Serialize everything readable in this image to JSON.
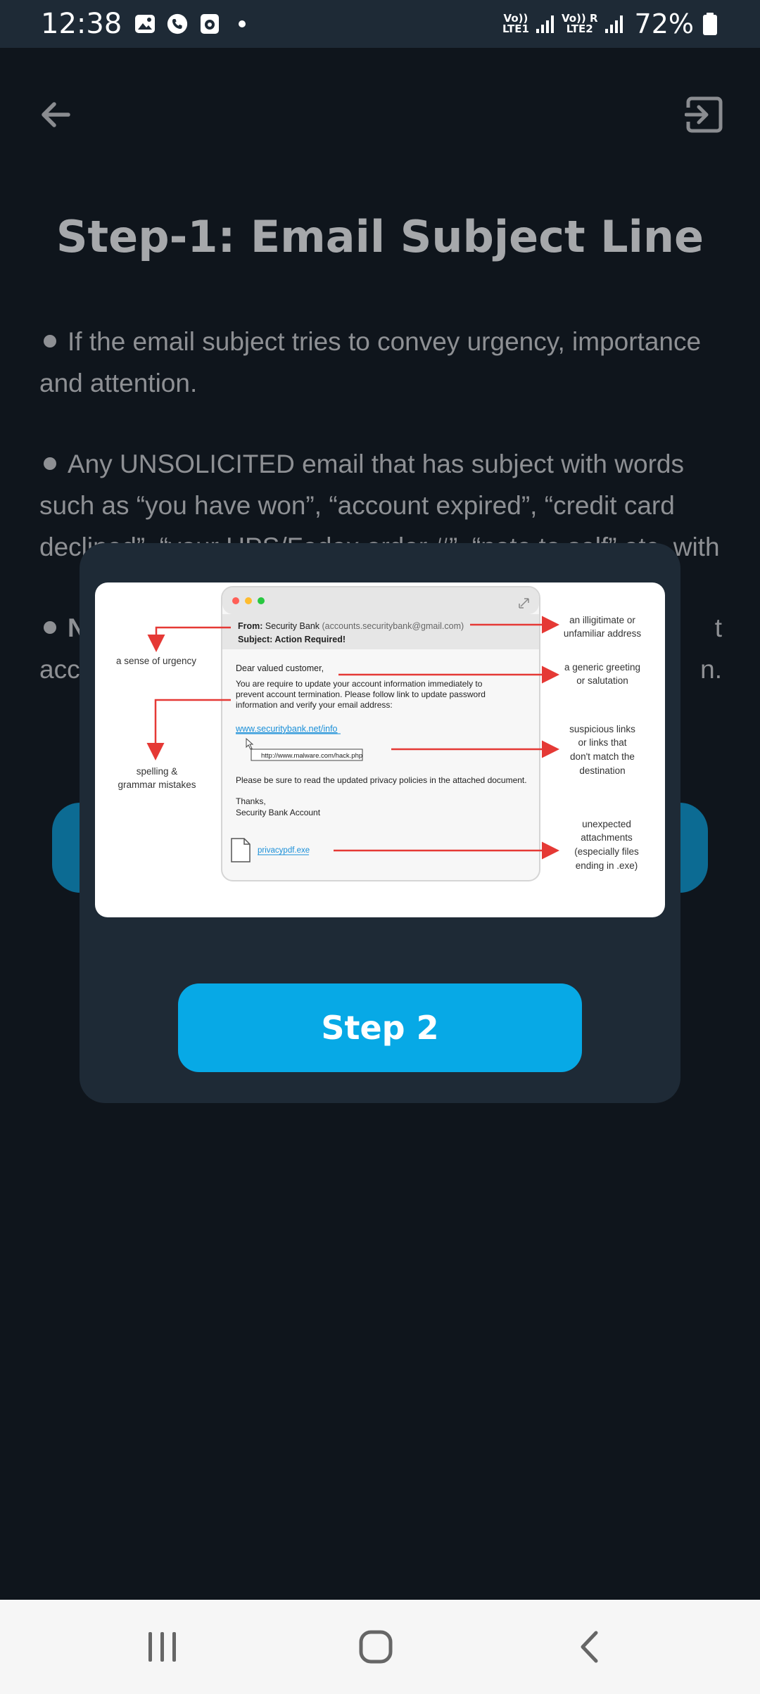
{
  "status_bar": {
    "time": "12:38",
    "lte1": "Vo))\nLTE1",
    "lte2": "Vo)) R\nLTE2",
    "battery": "72%"
  },
  "header": {
    "back_icon": "arrow-left-icon",
    "exit_icon": "exit-icon"
  },
  "page": {
    "title": "Step-1: Email Subject Line",
    "bullets": [
      "If the email subject tries to convey urgency, importance and attention.",
      "Any UNSOLICITED email that has subject with words such as “you have won”, “account expired”, “credit card declined”, “your UPS/Fedex order #”, “note to self” etc. with"
    ],
    "bullet3_start": "N",
    "bullet3_end": "t",
    "bullet3_line2_start": "acc",
    "bullet3_line2_end": "n."
  },
  "modal": {
    "illustration": {
      "from_label": "From:",
      "from_name": "Security Bank",
      "from_addr": "(accounts.securitybank@gmail.com)",
      "subject": "Subject: Action Required!",
      "greeting": "Dear valued customer,",
      "body1": "You are require to update your account information immediately to",
      "body2": "prevent account termination. Please follow link to update password",
      "body3": "information and verify your email address:",
      "link": "www.securitybank.net/info",
      "tooltip": "http://www.malware.com/hack.php",
      "privacy": "Please be sure to read the updated privacy policies in the attached document.",
      "thanks": "Thanks,",
      "signature": "Security Bank Account",
      "attachment": "privacypdf.exe",
      "ann_urgency": "a sense of urgency",
      "ann_illegit1": "an illigitimate or",
      "ann_illegit2": "unfamiliar address",
      "ann_greet1": "a generic greeting",
      "ann_greet2": "or salutation",
      "ann_spell1": "spelling &",
      "ann_spell2": "grammar mistakes",
      "ann_links1": "suspicious links",
      "ann_links2": "or links that",
      "ann_links3": "don't match the",
      "ann_links4": "destination",
      "ann_att1": "unexpected",
      "ann_att2": "attachments",
      "ann_att3": "(especially files",
      "ann_att4": "ending in .exe)"
    },
    "button_label": "Step 2"
  },
  "colors": {
    "accent": "#07a9e6",
    "modal_bg": "#1e2a36",
    "arrow_red": "#e53935"
  }
}
